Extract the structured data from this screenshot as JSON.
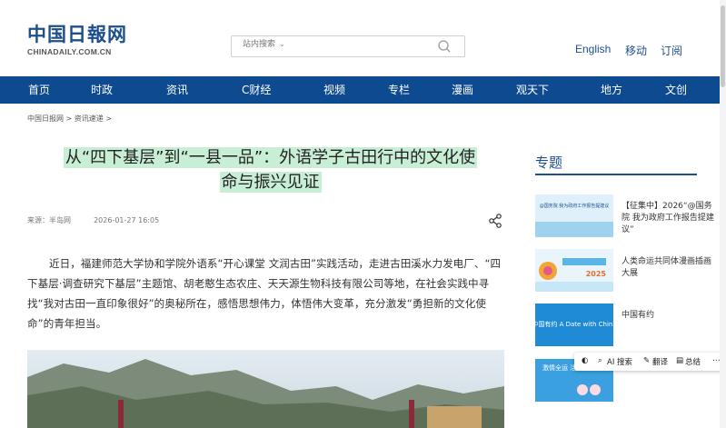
{
  "header": {
    "logo_cn": "中国日報网",
    "logo_en": "CHINADAILY.COM.CN",
    "search_placeholder": "站内搜索",
    "links": [
      "English",
      "移动",
      "订阅"
    ]
  },
  "nav": {
    "items": [
      "首页",
      "时政",
      "资讯",
      "C财经",
      "视频",
      "专栏",
      "漫画",
      "观天下",
      "地方",
      "文创"
    ]
  },
  "breadcrumb": "中国日报网 > 资讯速递 >",
  "article": {
    "title_line1": "从“四下基层”到“一县一品”：外语学子古田行中的文化使",
    "title_line2": "命与振兴见证",
    "source": "来源：半岛网",
    "time": "2026-01-27 16:05",
    "body": "近日，福建师范大学协和学院外语系“开心课堂 文润古田”实践活动，走进古田溪水力发电厂、“四下基层·调查研究下基层”主题馆、胡老憨生态农庄、天天源生物科技有限公司等地，在社会实践中寻找“我对古田一直印象很好”的奥秘所在，感悟思想伟力，体悟伟大变革，充分激发“勇担新的文化使命”的青年担当。"
  },
  "sidebar": {
    "title": "专题",
    "items": [
      {
        "text": "【征集中】2026“@国务院 我为政府工作报告提建议”",
        "thumb_caption": "@国务院 我为政府工作报告提建议"
      },
      {
        "text": "人类命运共同体漫画插画大展",
        "thumb_caption": "2025"
      },
      {
        "text": "中国有约",
        "thumb_caption": "中国有约 A Date with China"
      },
      {
        "text": "",
        "thumb_caption": "激情全运 活力大湾区"
      }
    ]
  },
  "toolbar": {
    "ai_search": "AI 搜索",
    "translate": "翻译",
    "summary": "总结"
  },
  "colors": {
    "brand_blue": "#0d4a8f",
    "title_highlight": "#c8efd6"
  }
}
